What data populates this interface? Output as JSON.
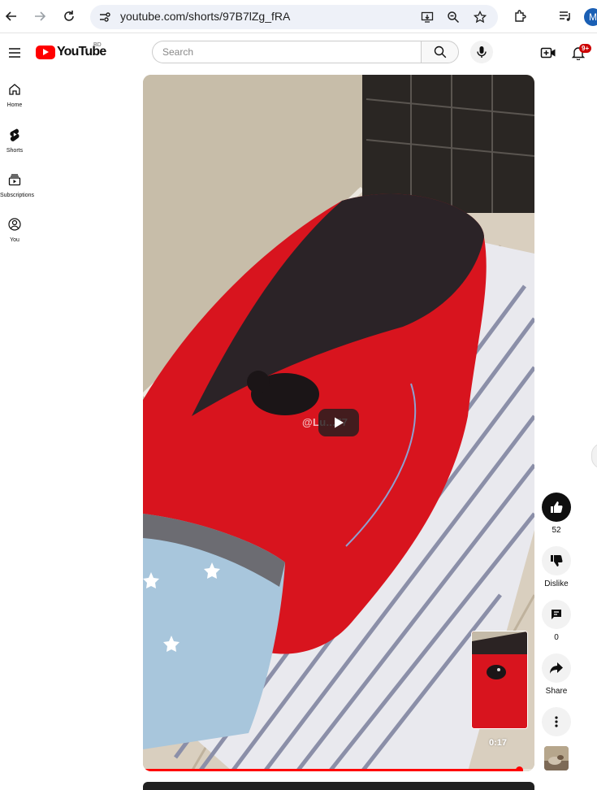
{
  "browser": {
    "url": "youtube.com/shorts/97B7lZg_fRA",
    "profile_initial": "M"
  },
  "masthead": {
    "logo_text": "YouTube",
    "country_code": "BD",
    "search_placeholder": "Search",
    "notification_count": "9+"
  },
  "sidebar": {
    "items": [
      {
        "label": "Home",
        "icon": "home-icon"
      },
      {
        "label": "Shorts",
        "icon": "shorts-icon"
      },
      {
        "label": "Subscriptions",
        "icon": "subscriptions-icon"
      },
      {
        "label": "You",
        "icon": "you-icon"
      }
    ]
  },
  "video": {
    "watermark": "@Lu...77",
    "time": "0:17",
    "progress": 0.96
  },
  "actions": {
    "like_count": "52",
    "dislike_label": "Dislike",
    "comment_count": "0",
    "share_label": "Share"
  },
  "colors": {
    "brand_red": "#ff0000",
    "sleeping_bag_red": "#d8141e",
    "badge_red": "#cc0000"
  }
}
